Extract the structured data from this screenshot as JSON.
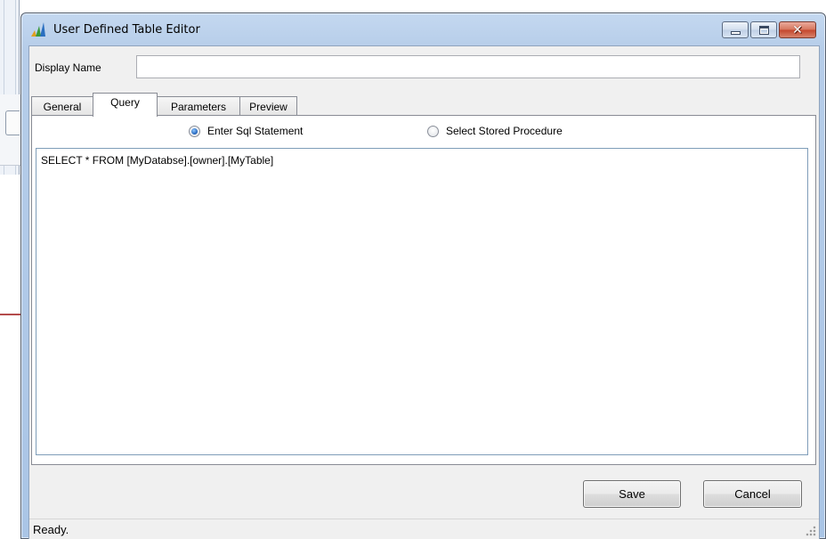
{
  "window": {
    "title": "User Defined Table Editor",
    "icon": "app-bars-icon",
    "caption_buttons": [
      "minimize-icon",
      "maximize-icon",
      "close-icon"
    ]
  },
  "display_name": {
    "label": "Display Name",
    "value": "",
    "placeholder": ""
  },
  "tabs": [
    {
      "label": "General",
      "active": false
    },
    {
      "label": "Query",
      "active": true
    },
    {
      "label": "Parameters",
      "active": false
    },
    {
      "label": "Preview",
      "active": false
    }
  ],
  "query": {
    "options": [
      {
        "label": "Enter Sql Statement",
        "checked": true
      },
      {
        "label": "Select Stored Procedure",
        "checked": false
      }
    ],
    "sql_text": "SELECT * FROM [MyDatabse].[owner].[MyTable]"
  },
  "buttons": {
    "save_label": "Save",
    "cancel_label": "Cancel"
  },
  "status": {
    "text": "Ready."
  },
  "colors": {
    "title_bar": "#b6cde9",
    "close_button": "#c4462c",
    "accent_line": "#b44b4b"
  }
}
